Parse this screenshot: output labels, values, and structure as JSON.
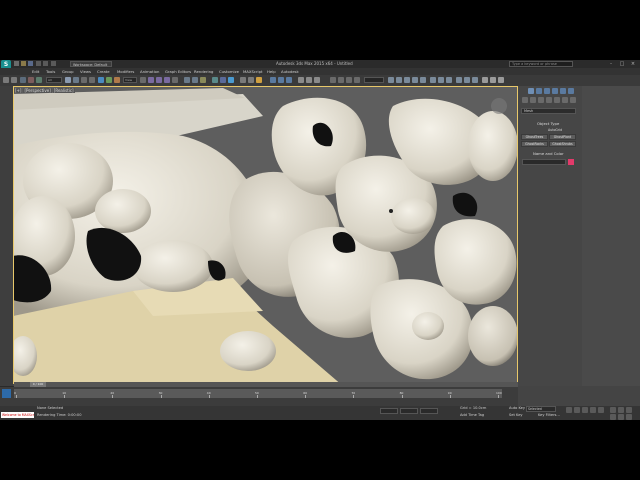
{
  "app": {
    "title": "Autodesk 3ds Max 2015 x64 - Untitled",
    "logo_letter": "S",
    "workspace": "Workspace: Default",
    "search_placeholder": "Type a keyword or phrase",
    "window_controls": [
      "-",
      "□",
      "×"
    ]
  },
  "menu": [
    "Edit",
    "Tools",
    "Group",
    "Views",
    "Create",
    "Modifiers",
    "Animation",
    "Graph Editors",
    "Rendering",
    "Customize",
    "MAXScript",
    "Help",
    "Autodesk"
  ],
  "toolbar": {
    "selection_filter": "All",
    "view_dropdown": "View",
    "icons": [
      "undo-icon",
      "redo-icon",
      "link-icon",
      "unlink-icon",
      "bind-icon",
      "select-icon",
      "select-by-name-icon",
      "rect-select-icon",
      "window-crossing-icon",
      "move-icon",
      "rotate-icon",
      "scale-icon",
      "pivot-icon",
      "snap-icon",
      "angle-snap-icon",
      "percent-snap-icon",
      "spinner-snap-icon",
      "mirror-icon",
      "align-icon",
      "layer-icon",
      "curve-editor-icon",
      "schematic-icon",
      "material-editor-icon",
      "render-setup-icon",
      "render-frame-icon",
      "render-icon"
    ]
  },
  "viewport": {
    "labels": [
      "[+]",
      "[Perspective]",
      "[Realistic]"
    ],
    "accent_color": "#e8c86a"
  },
  "command_panel": {
    "category_dropdown": "Mesh",
    "object_type_header": "Object Type",
    "autogrid_label": "AutoGrid",
    "buttons": [
      "GhostTrees",
      "GhostPlant",
      "GhostRocks",
      "GhostShrubs"
    ],
    "name_color_header": "Name and Color",
    "name_value": "",
    "object_color": "#e23a6a"
  },
  "timeline": {
    "frame_display": "0 / 100",
    "ticks": [
      "0",
      "10",
      "20",
      "30",
      "40",
      "50",
      "60",
      "70",
      "80",
      "90",
      "100"
    ]
  },
  "status": {
    "maxscript_text": "Welcome to MAXScript",
    "selection_text": "None Selected",
    "prompt_text": "Rendering Time: 0:00:00",
    "grid_text": "Grid = 10.0cm",
    "auto_key_label": "Auto Key",
    "selected_label": "Selected",
    "set_key_label": "Set Key",
    "key_filters_label": "Key Filters...",
    "add_time_tag": "Add Time Tag"
  }
}
